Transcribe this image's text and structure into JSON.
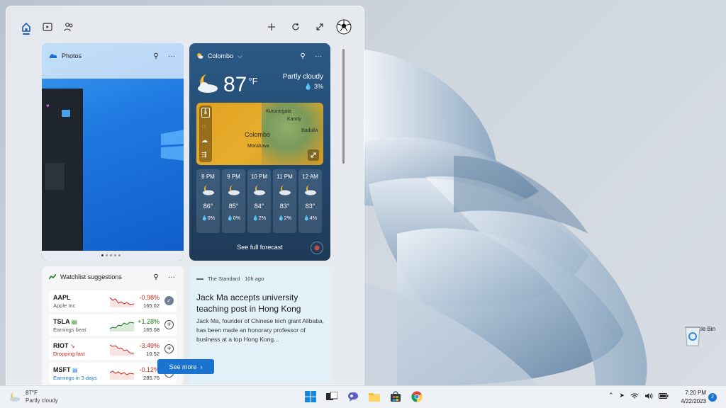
{
  "board": {
    "toolbar": {
      "home_icon": "home-icon",
      "video_icon": "video-icon",
      "people_icon": "people-icon",
      "add_icon": "plus-icon",
      "refresh_icon": "refresh-icon",
      "expand_icon": "expand-icon",
      "avatar_icon": "soccer-ball-icon"
    }
  },
  "photos": {
    "title": "Photos",
    "pin_icon": "pin-icon",
    "more_icon": "more-icon"
  },
  "weather": {
    "location": "Colombo",
    "temperature": "87",
    "unit": "°F",
    "condition": "Partly cloudy",
    "precipitation": "3%",
    "map_places": [
      "Kurunegala",
      "Kandy",
      "Colombo",
      "Badulla",
      "Moratuwa"
    ],
    "hourly": [
      {
        "time": "8 PM",
        "temp": "86°",
        "precip": "0%"
      },
      {
        "time": "9 PM",
        "temp": "85°",
        "precip": "0%"
      },
      {
        "time": "10 PM",
        "temp": "84°",
        "precip": "2%"
      },
      {
        "time": "11 PM",
        "temp": "83°",
        "precip": "2%"
      },
      {
        "time": "12 AM",
        "temp": "83°",
        "precip": "4%"
      }
    ],
    "forecast_link": "See full forecast"
  },
  "watchlist": {
    "title": "Watchlist suggestions",
    "stocks": [
      {
        "symbol": "AAPL",
        "subtitle": "Apple Inc",
        "change": "-0.98%",
        "price": "165.02",
        "trend": "down",
        "added": true
      },
      {
        "symbol": "TSLA",
        "subtitle": "Earnings beat",
        "change": "+1.28%",
        "price": "165.08",
        "trend": "up",
        "added": false
      },
      {
        "symbol": "RIOT",
        "subtitle": "Dropping fast",
        "change": "-3.49%",
        "price": "10.52",
        "trend": "down",
        "added": false
      },
      {
        "symbol": "MSFT",
        "subtitle": "Earnings in 3 days",
        "change": "-0.12%",
        "price": "285.76",
        "trend": "down",
        "added": false
      }
    ]
  },
  "news": {
    "source": "The Standard · 10h ago",
    "headline": "Jack Ma accepts university teaching post in Hong Kong",
    "body": "Jack Ma, founder of Chinese tech giant Alibaba, has been made an honorary professor of business at a top Hong Kong..."
  },
  "see_more": "See more",
  "desktop": {
    "recycle_bin": "Recycle Bin"
  },
  "taskbar": {
    "weather_temp": "87°F",
    "weather_cond": "Partly cloudy",
    "time": "7:20 PM",
    "date": "4/22/2023",
    "notifications": "2",
    "apps": [
      "windows-start-icon",
      "task-view-icon",
      "chat-icon",
      "file-explorer-icon",
      "store-icon",
      "chrome-icon"
    ]
  }
}
